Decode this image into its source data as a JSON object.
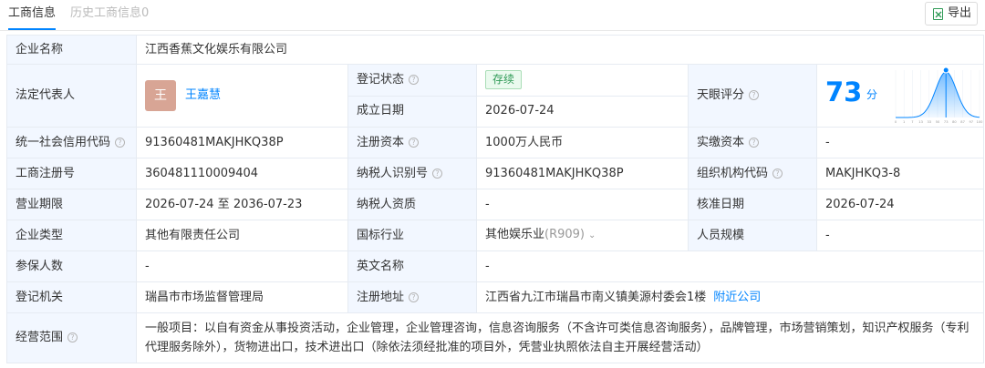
{
  "tabs": {
    "active": "工商信息",
    "history": "历史工商信息0"
  },
  "export": {
    "label": "导出"
  },
  "fields": {
    "company_name": {
      "key": "企业名称",
      "value": "江西香蕉文化娱乐有限公司"
    },
    "legal_rep": {
      "key": "法定代表人",
      "avatar": "王",
      "name": "王嘉慧"
    },
    "reg_status": {
      "key": "登记状态",
      "value": "存续"
    },
    "established": {
      "key": "成立日期",
      "value": "2026-07-24"
    },
    "tianyan_score": {
      "key": "天眼评分",
      "value": "73",
      "unit": "分"
    },
    "credit_code": {
      "key": "统一社会信用代码",
      "value": "91360481MAKJHKQ38P"
    },
    "reg_capital": {
      "key": "注册资本",
      "value": "1000万人民币"
    },
    "paid_capital": {
      "key": "实缴资本",
      "value": "-"
    },
    "biz_reg_no": {
      "key": "工商注册号",
      "value": "360481110009404"
    },
    "taxpayer_id": {
      "key": "纳税人识别号",
      "value": "91360481MAKJHKQ38P"
    },
    "org_code": {
      "key": "组织机构代码",
      "value": "MAKJHKQ3-8"
    },
    "term": {
      "key": "营业期限",
      "value": "2026-07-24 至 2036-07-23"
    },
    "taxpayer_qual": {
      "key": "纳税人资质",
      "value": "-"
    },
    "approval_date": {
      "key": "核准日期",
      "value": "2026-07-24"
    },
    "company_type": {
      "key": "企业类型",
      "value": "其他有限责任公司"
    },
    "industry": {
      "key": "国标行业",
      "value": "其他娱乐业",
      "code": "(R909)"
    },
    "staff_size": {
      "key": "人员规模",
      "value": "-"
    },
    "insured": {
      "key": "参保人数",
      "value": "-"
    },
    "english_name": {
      "key": "英文名称",
      "value": "-"
    },
    "authority": {
      "key": "登记机关",
      "value": "瑞昌市市场监督管理局"
    },
    "address": {
      "key": "注册地址",
      "value": "江西省九江市瑞昌市南义镇美源村委会1楼",
      "link": "附近公司"
    },
    "scope": {
      "key": "经营范围",
      "value": "一般项目：以自有资金从事投资活动，企业管理，企业管理咨询，信息咨询服务（不含许可类信息咨询服务），品牌管理，市场营销策划，知识产权服务（专利代理服务除外），货物进出口，技术进出口（除依法须经批准的项目外，凭营业执照依法自主开展经营活动）"
    }
  },
  "score_chart": {
    "x_ticks": [
      "0",
      "1",
      "7",
      "13",
      "33",
      "50",
      "73",
      "80",
      "87",
      "97",
      "100"
    ],
    "marker": 73,
    "color": "#0084ff"
  }
}
